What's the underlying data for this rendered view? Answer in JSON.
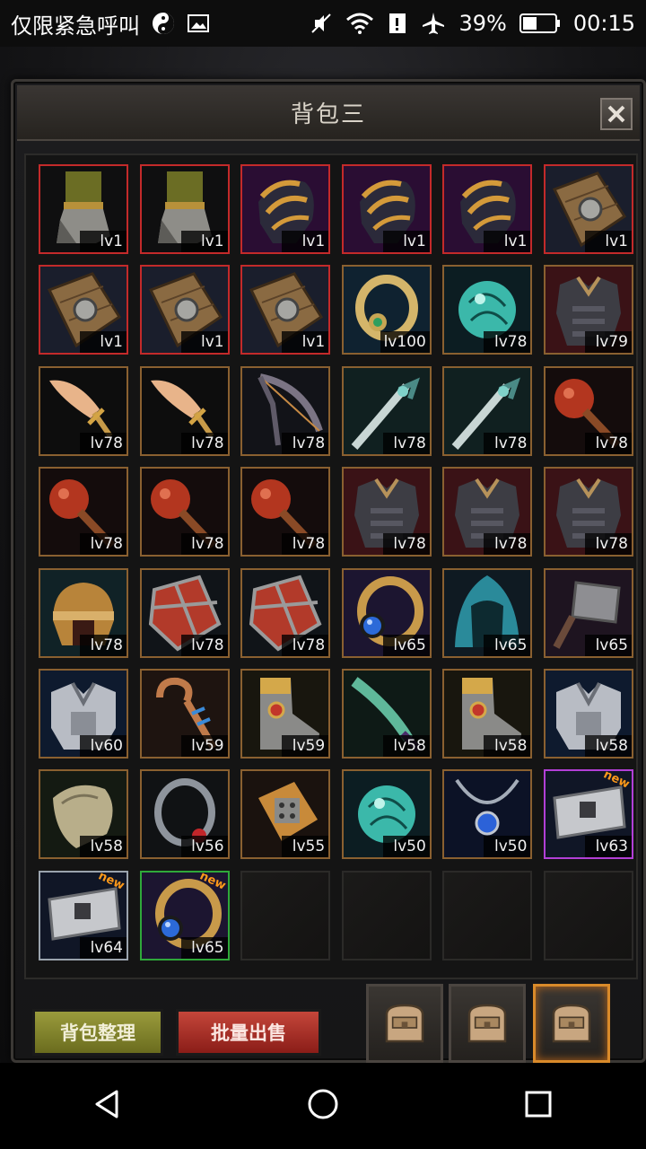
{
  "status_bar": {
    "carrier_text": "仅限紧急呼叫",
    "battery": "39%",
    "time": "00:15"
  },
  "panel": {
    "title": "背包三",
    "close_icon": "close-icon"
  },
  "items": [
    {
      "level": "lv1",
      "rarity": "red",
      "icon": "leg-armor-icon",
      "new": false
    },
    {
      "level": "lv1",
      "rarity": "red",
      "icon": "leg-armor-icon",
      "new": false
    },
    {
      "level": "lv1",
      "rarity": "red",
      "icon": "dark-shoulder-armor-icon",
      "new": false
    },
    {
      "level": "lv1",
      "rarity": "red",
      "icon": "dark-shoulder-armor-icon",
      "new": false
    },
    {
      "level": "lv1",
      "rarity": "red",
      "icon": "dark-shoulder-armor-icon",
      "new": false
    },
    {
      "level": "lv1",
      "rarity": "red",
      "icon": "wooden-shield-icon",
      "new": false
    },
    {
      "level": "lv1",
      "rarity": "red",
      "icon": "wooden-shield-icon",
      "new": false
    },
    {
      "level": "lv1",
      "rarity": "red",
      "icon": "wooden-shield-icon",
      "new": false
    },
    {
      "level": "lv1",
      "rarity": "red",
      "icon": "wooden-shield-icon",
      "new": false
    },
    {
      "level": "lv100",
      "rarity": "orange",
      "icon": "gold-ring-icon",
      "new": false
    },
    {
      "level": "lv78",
      "rarity": "orange",
      "icon": "teal-orb-icon",
      "new": false
    },
    {
      "level": "lv79",
      "rarity": "orange",
      "icon": "dark-chest-armor-icon",
      "new": false
    },
    {
      "level": "lv78",
      "rarity": "orange",
      "icon": "feather-blade-icon",
      "new": false
    },
    {
      "level": "lv78",
      "rarity": "orange",
      "icon": "feather-blade-icon",
      "new": false
    },
    {
      "level": "lv78",
      "rarity": "orange",
      "icon": "bow-icon",
      "new": false
    },
    {
      "level": "lv78",
      "rarity": "orange",
      "icon": "curved-sword-icon",
      "new": false
    },
    {
      "level": "lv78",
      "rarity": "orange",
      "icon": "curved-sword-icon",
      "new": false
    },
    {
      "level": "lv78",
      "rarity": "orange",
      "icon": "red-mace-icon",
      "new": false
    },
    {
      "level": "lv78",
      "rarity": "orange",
      "icon": "red-mace-icon",
      "new": false
    },
    {
      "level": "lv78",
      "rarity": "orange",
      "icon": "red-mace-icon",
      "new": false
    },
    {
      "level": "lv78",
      "rarity": "orange",
      "icon": "red-mace-icon",
      "new": false
    },
    {
      "level": "lv78",
      "rarity": "orange",
      "icon": "dark-chest-armor-icon",
      "new": false
    },
    {
      "level": "lv78",
      "rarity": "orange",
      "icon": "dark-chest-armor-icon",
      "new": false
    },
    {
      "level": "lv78",
      "rarity": "orange",
      "icon": "dark-chest-armor-icon",
      "new": false
    },
    {
      "level": "lv78",
      "rarity": "orange",
      "icon": "gold-helmet-icon",
      "new": false
    },
    {
      "level": "lv78",
      "rarity": "orange",
      "icon": "red-shield-icon",
      "new": false
    },
    {
      "level": "lv78",
      "rarity": "orange",
      "icon": "red-shield-icon",
      "new": false
    },
    {
      "level": "lv65",
      "rarity": "orange",
      "icon": "blue-gem-ring-icon",
      "new": false
    },
    {
      "level": "lv65",
      "rarity": "orange",
      "icon": "teal-hood-icon",
      "new": false
    },
    {
      "level": "lv65",
      "rarity": "orange",
      "icon": "stone-hammer-icon",
      "new": false
    },
    {
      "level": "lv60",
      "rarity": "orange",
      "icon": "silver-chest-armor-icon",
      "new": false
    },
    {
      "level": "lv59",
      "rarity": "orange",
      "icon": "hook-staff-icon",
      "new": false
    },
    {
      "level": "lv59",
      "rarity": "orange",
      "icon": "gold-boot-icon",
      "new": false
    },
    {
      "level": "lv58",
      "rarity": "orange",
      "icon": "green-sword-icon",
      "new": false
    },
    {
      "level": "lv58",
      "rarity": "orange",
      "icon": "gold-boot-icon",
      "new": false
    },
    {
      "level": "lv58",
      "rarity": "orange",
      "icon": "silver-chest-armor-icon",
      "new": false
    },
    {
      "level": "lv58",
      "rarity": "orange",
      "icon": "stone-pauldron-icon",
      "new": false
    },
    {
      "level": "lv56",
      "rarity": "orange",
      "icon": "silver-ring-icon",
      "new": false
    },
    {
      "level": "lv55",
      "rarity": "orange",
      "icon": "gold-gauntlet-icon",
      "new": false
    },
    {
      "level": "lv50",
      "rarity": "orange",
      "icon": "teal-orb-icon",
      "new": false
    },
    {
      "level": "lv50",
      "rarity": "orange",
      "icon": "sapphire-necklace-icon",
      "new": false
    },
    {
      "level": "lv63",
      "rarity": "purple",
      "icon": "silver-hammer-icon",
      "new": true
    },
    {
      "level": "lv64",
      "rarity": "grey",
      "icon": "silver-hammer-icon",
      "new": true
    },
    {
      "level": "lv65",
      "rarity": "green",
      "icon": "blue-gem-ring-icon",
      "new": true
    },
    {
      "level": "",
      "rarity": "empty",
      "icon": "",
      "new": false
    },
    {
      "level": "",
      "rarity": "empty",
      "icon": "",
      "new": false
    },
    {
      "level": "",
      "rarity": "empty",
      "icon": "",
      "new": false
    },
    {
      "level": "",
      "rarity": "empty",
      "icon": "",
      "new": false
    }
  ],
  "new_badge_text": "new",
  "buttons": {
    "sort_label": "背包整理",
    "sell_label": "批量出售"
  },
  "bag_tabs": [
    {
      "icon": "backpack-icon",
      "active": false
    },
    {
      "icon": "backpack-icon",
      "active": false
    },
    {
      "icon": "backpack-icon",
      "active": true
    }
  ],
  "colors": {
    "rarity_red": "#c32a2a",
    "rarity_orange": "#8a6030",
    "rarity_purple": "#b23fd6",
    "rarity_green": "#2fa83a",
    "rarity_grey": "#9aa3ad"
  }
}
